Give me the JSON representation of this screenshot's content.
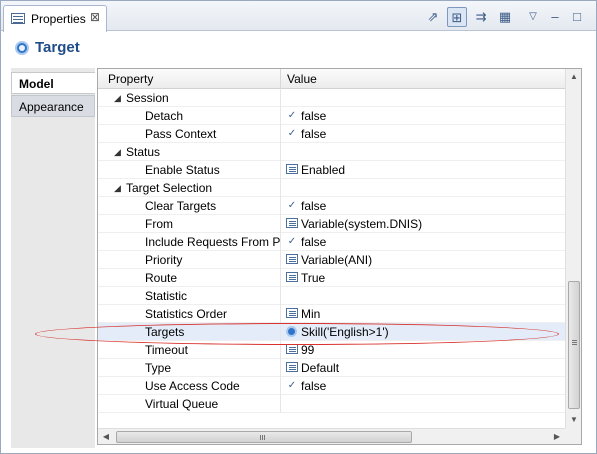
{
  "tab": {
    "title": "Properties",
    "close_glyph": "⊠"
  },
  "toolbar": {
    "icons": [
      "pin-icon",
      "tree-view-icon",
      "filter-icon",
      "advanced-icon",
      "view-menu-icon",
      "minimize-icon",
      "maximize-icon"
    ],
    "glyphs": [
      "⇗",
      "⊞",
      "⇉",
      "▦",
      "▽",
      "–",
      "□"
    ]
  },
  "header": {
    "title": "Target",
    "icon": "target-icon"
  },
  "left_tabs": [
    {
      "label": "Model",
      "active": true
    },
    {
      "label": "Appearance",
      "active": false
    }
  ],
  "table": {
    "columns": [
      "Property",
      "Value"
    ],
    "rows": [
      {
        "prop": "Session",
        "level": 0,
        "expander": "◢",
        "value": "",
        "icon": ""
      },
      {
        "prop": "Detach",
        "level": 1,
        "value": "false",
        "icon": "boolean-icon"
      },
      {
        "prop": "Pass Context",
        "level": 1,
        "value": "false",
        "icon": "boolean-icon"
      },
      {
        "prop": "Status",
        "level": 0,
        "expander": "◢",
        "value": "",
        "icon": ""
      },
      {
        "prop": "Enable Status",
        "level": 1,
        "value": "Enabled",
        "icon": "list-icon"
      },
      {
        "prop": "Target Selection",
        "level": 0,
        "expander": "◢",
        "value": "",
        "icon": ""
      },
      {
        "prop": "Clear Targets",
        "level": 1,
        "value": "false",
        "icon": "boolean-icon"
      },
      {
        "prop": "From",
        "level": 1,
        "value": "Variable(system.DNIS)",
        "icon": "list-icon"
      },
      {
        "prop": "Include Requests From Pr",
        "level": 1,
        "value": "false",
        "icon": "boolean-icon"
      },
      {
        "prop": "Priority",
        "level": 1,
        "value": "Variable(ANI)",
        "icon": "list-icon"
      },
      {
        "prop": "Route",
        "level": 1,
        "value": "True",
        "icon": "list-icon"
      },
      {
        "prop": "Statistic",
        "level": 1,
        "value": "",
        "icon": ""
      },
      {
        "prop": "Statistics Order",
        "level": 1,
        "value": "Min",
        "icon": "list-icon"
      },
      {
        "prop": "Targets",
        "level": 1,
        "value": "Skill('English>1')",
        "icon": "target-icon",
        "selected": true
      },
      {
        "prop": "Timeout",
        "level": 1,
        "value": "99",
        "icon": "list-icon"
      },
      {
        "prop": "Type",
        "level": 1,
        "value": "Default",
        "icon": "list-icon"
      },
      {
        "prop": "Use Access Code",
        "level": 1,
        "value": "false",
        "icon": "boolean-icon"
      },
      {
        "prop": "Virtual Queue",
        "level": 1,
        "value": "",
        "icon": ""
      }
    ]
  },
  "scroll": {
    "up_glyph": "▲",
    "down_glyph": "▼",
    "left_glyph": "◀",
    "right_glyph": "▶"
  },
  "colors": {
    "annotation": "#d8332f",
    "selection": "#e3ecf8",
    "header_title": "#1f4d8a"
  }
}
